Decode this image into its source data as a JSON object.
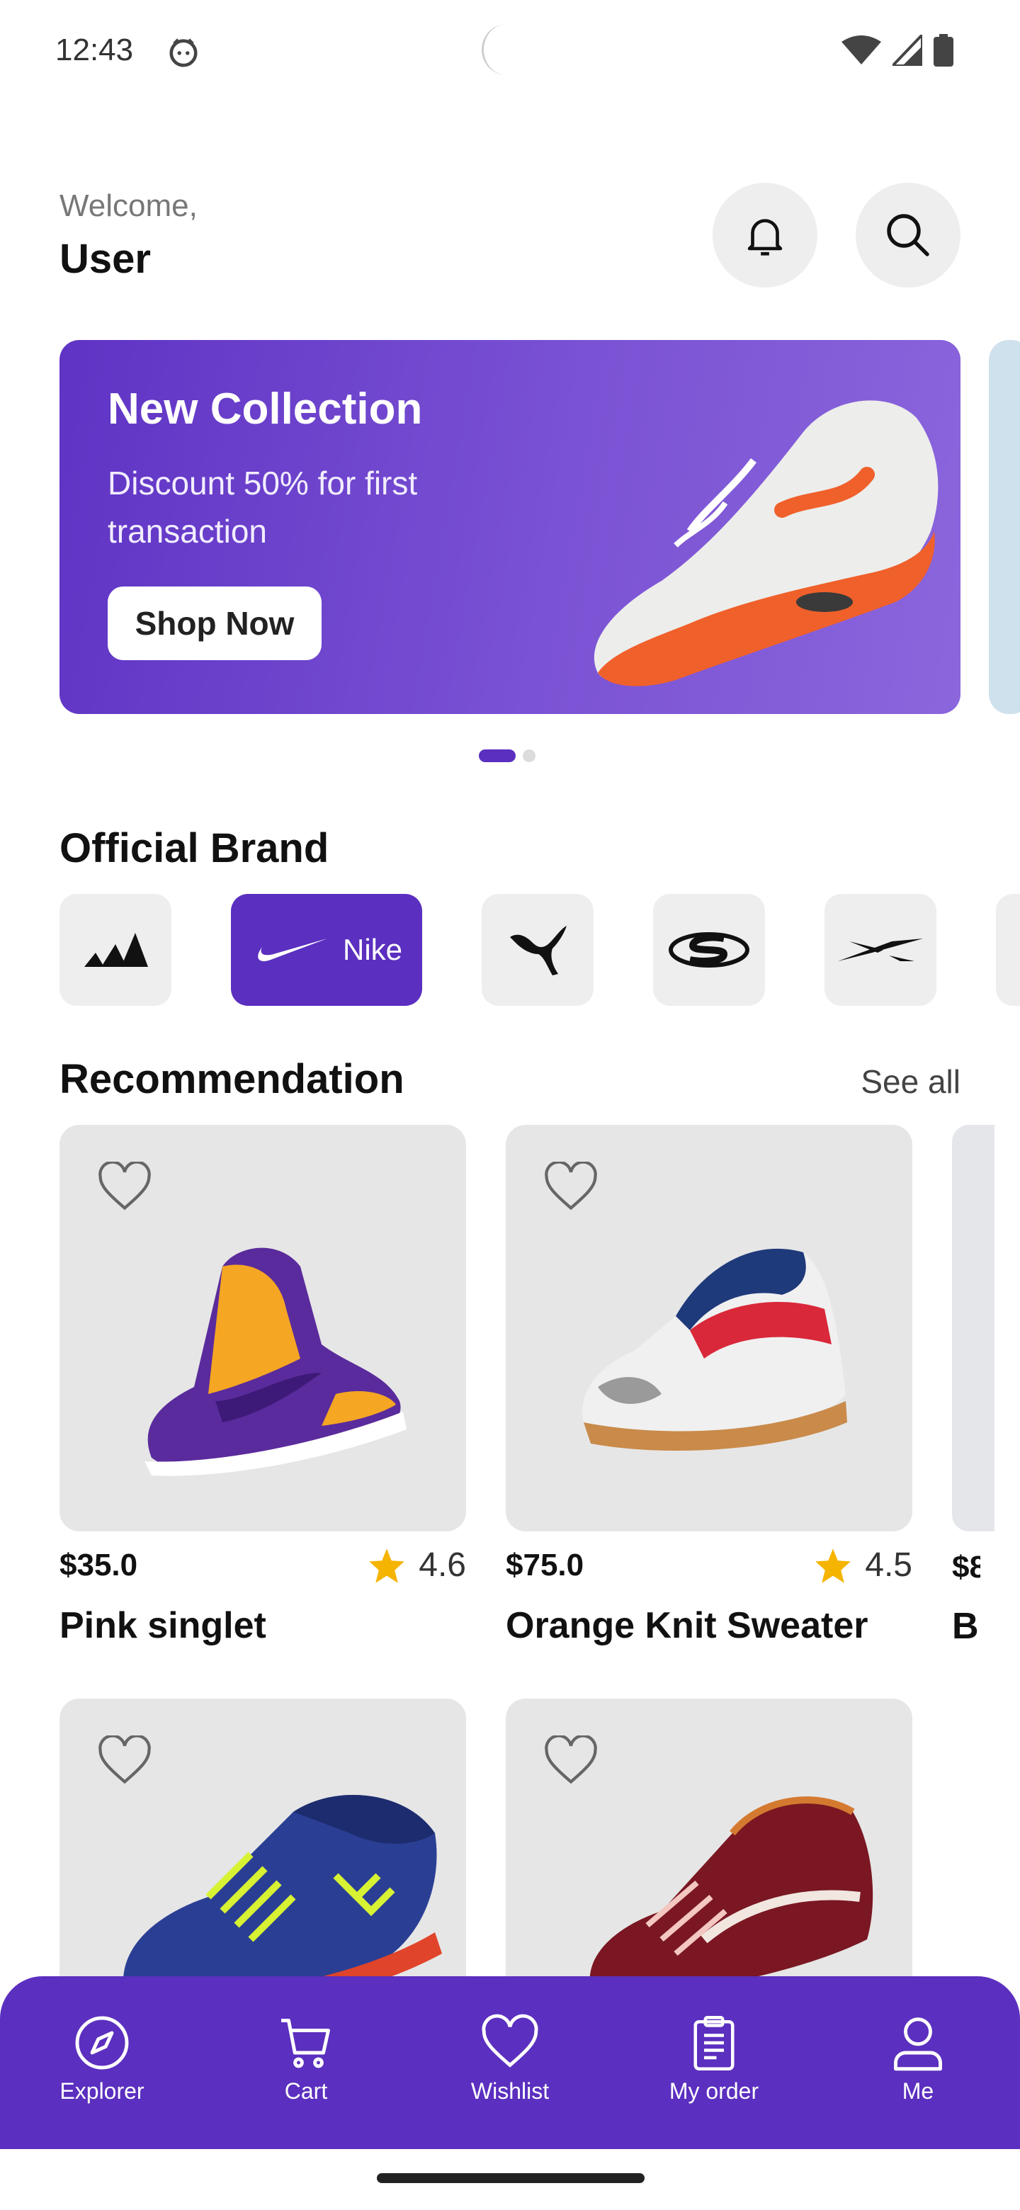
{
  "status_bar": {
    "time": "12:43"
  },
  "header": {
    "welcome": "Welcome,",
    "user": "User"
  },
  "banner": {
    "title": "New Collection",
    "subtitle": "Discount 50% for first transaction",
    "cta": "Shop Now",
    "accent": "#5b2fbf"
  },
  "brands": {
    "title": "Official Brand",
    "items": [
      {
        "icon": "adidas-logo-icon",
        "label": ""
      },
      {
        "icon": "nike-logo-icon",
        "label": "Nike",
        "selected": true
      },
      {
        "icon": "puma-logo-icon",
        "label": ""
      },
      {
        "icon": "skechers-logo-icon",
        "label": ""
      },
      {
        "icon": "reebok-logo-icon",
        "label": ""
      }
    ]
  },
  "recommendation": {
    "title": "Recommendation",
    "see_all": "See all",
    "products": [
      {
        "price": "$35.0",
        "rating": "4.6",
        "name": "Pink singlet"
      },
      {
        "price": "$75.0",
        "rating": "4.5",
        "name": "Orange Knit Sweater"
      },
      {
        "price": "$8",
        "name": "B"
      }
    ]
  },
  "bottom_nav": [
    {
      "label": "Explorer",
      "icon": "compass-icon"
    },
    {
      "label": "Cart",
      "icon": "cart-icon"
    },
    {
      "label": "Wishlist",
      "icon": "heart-icon"
    },
    {
      "label": "My order",
      "icon": "clipboard-icon"
    },
    {
      "label": "Me",
      "icon": "user-icon"
    }
  ]
}
